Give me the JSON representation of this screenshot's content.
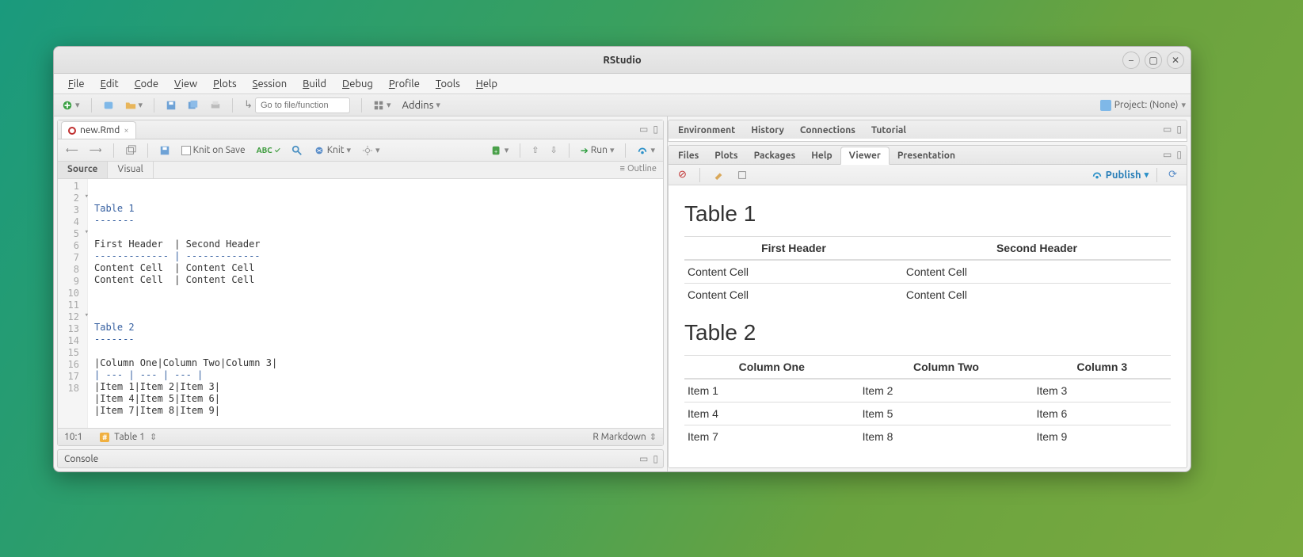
{
  "window": {
    "title": "RStudio"
  },
  "menubar": [
    "File",
    "Edit",
    "Code",
    "View",
    "Plots",
    "Session",
    "Build",
    "Debug",
    "Profile",
    "Tools",
    "Help"
  ],
  "maintoolbar": {
    "goto_placeholder": "Go to file/function",
    "addins": "Addins",
    "project": "Project: (None)"
  },
  "file_tab": {
    "name": "new.Rmd"
  },
  "editor_toolbar": {
    "knit_on_save": "Knit on Save",
    "knit": "Knit",
    "run": "Run",
    "outline": "Outline"
  },
  "src_visual": {
    "source": "Source",
    "visual": "Visual"
  },
  "code_lines": [
    "Table 1",
    "-------",
    "",
    "First Header  | Second Header",
    "------------- | -------------",
    "Content Cell  | Content Cell",
    "Content Cell  | Content Cell",
    "",
    "",
    "",
    "Table 2",
    "-------",
    "",
    "|Column One|Column Two|Column 3|",
    "| --- | --- | --- |",
    "|Item 1|Item 2|Item 3|",
    "|Item 4|Item 5|Item 6|",
    "|Item 7|Item 8|Item 9|"
  ],
  "status": {
    "pos": "10:1",
    "crumb": "Table 1",
    "lang": "R Markdown"
  },
  "console": {
    "label": "Console"
  },
  "top_tabs": [
    "Environment",
    "History",
    "Connections",
    "Tutorial"
  ],
  "bot_tabs": [
    "Files",
    "Plots",
    "Packages",
    "Help",
    "Viewer",
    "Presentation"
  ],
  "bot_active": "Viewer",
  "viewer_tb": {
    "publish": "Publish"
  },
  "preview": {
    "t1": {
      "title": "Table 1",
      "headers": [
        "First Header",
        "Second Header"
      ],
      "rows": [
        [
          "Content Cell",
          "Content Cell"
        ],
        [
          "Content Cell",
          "Content Cell"
        ]
      ]
    },
    "t2": {
      "title": "Table 2",
      "headers": [
        "Column One",
        "Column Two",
        "Column 3"
      ],
      "rows": [
        [
          "Item 1",
          "Item 2",
          "Item 3"
        ],
        [
          "Item 4",
          "Item 5",
          "Item 6"
        ],
        [
          "Item 7",
          "Item 8",
          "Item 9"
        ]
      ]
    }
  }
}
